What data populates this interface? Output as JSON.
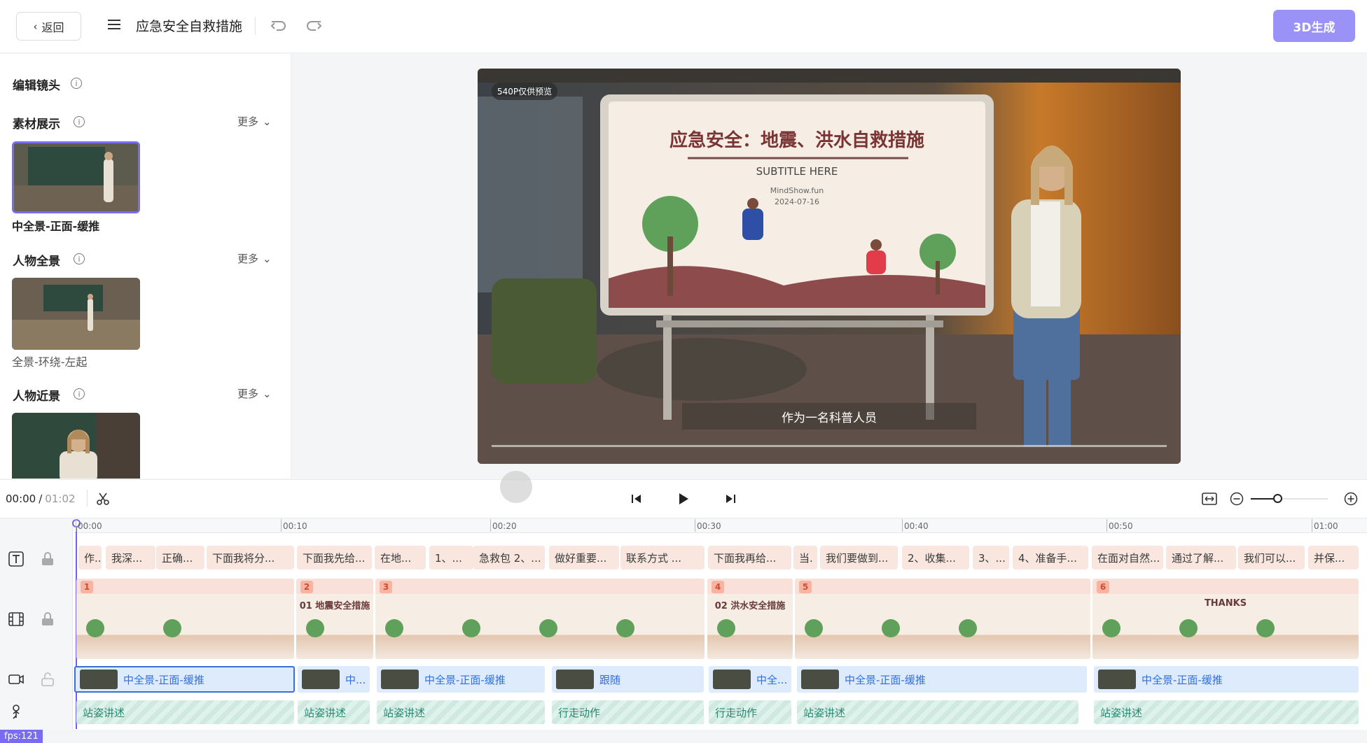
{
  "header": {
    "back_label": "返回",
    "project_title": "应急安全自救措施",
    "generate_label": "3D生成"
  },
  "left_panel": {
    "edit_shot_title": "编辑镜头",
    "sections": [
      {
        "title": "素材展示",
        "more": "更多",
        "item_caption": "中全景-正面-缓推"
      },
      {
        "title": "人物全景",
        "more": "更多",
        "item_caption": "全景-环绕-左起"
      },
      {
        "title": "人物近景",
        "more": "更多",
        "item_caption": ""
      }
    ]
  },
  "preview": {
    "quality_badge": "540P仅供预览",
    "slide_title": "应急安全：地震、洪水自救措施",
    "slide_subtitle": "SUBTITLE HERE",
    "slide_brand": "MindShow.fun",
    "slide_date": "2024-07-16",
    "caption": "作为一名科普人员"
  },
  "playback": {
    "current_time": "00:00",
    "separator": "/",
    "total_time": "01:02"
  },
  "timeline": {
    "ruler": [
      "00:00",
      "00:10",
      "00:20",
      "00:30",
      "00:40",
      "00:50",
      "01:00"
    ],
    "text_track": [
      "作..",
      "我深...",
      "正确...",
      "下面我将分...",
      "下面我先给...",
      "在地...",
      "1、...",
      "急救包 2、...",
      "做好重要...",
      "联系方式 ...",
      "下面我再给...",
      "当.",
      "我们要做到...",
      "2、收集...",
      "3、...",
      "4、准备手...",
      "在面对自然...",
      "通过了解...",
      "我们可以...",
      "并保..."
    ],
    "scenes": [
      {
        "num": "1",
        "label": ""
      },
      {
        "num": "2",
        "label": "01 地震安全措施"
      },
      {
        "num": "3",
        "label": ""
      },
      {
        "num": "4",
        "label": "02 洪水安全措施"
      },
      {
        "num": "5",
        "label": ""
      },
      {
        "num": "6",
        "label": "THANKS"
      }
    ],
    "camera_track": [
      "中全景-正面-缓推",
      "中...",
      "中全景-正面-缓推",
      "跟随",
      "中全...",
      "中全景-正面-缓推",
      "中全景-正面-缓推"
    ],
    "action_track": [
      "站姿讲述",
      "站姿讲述",
      "站姿讲述",
      "行走动作",
      "行走动作",
      "站姿讲述",
      "站姿讲述"
    ],
    "slide_thumb_texts": {
      "thanks": "THANKS",
      "sec1": "01",
      "sec2": "02"
    }
  },
  "debug": {
    "fps": "fps:121"
  },
  "colors": {
    "accent": "#9b92f8",
    "cam_text": "#2f6fde",
    "action_text": "#27896f",
    "scene_chip": "#f9e6df"
  }
}
